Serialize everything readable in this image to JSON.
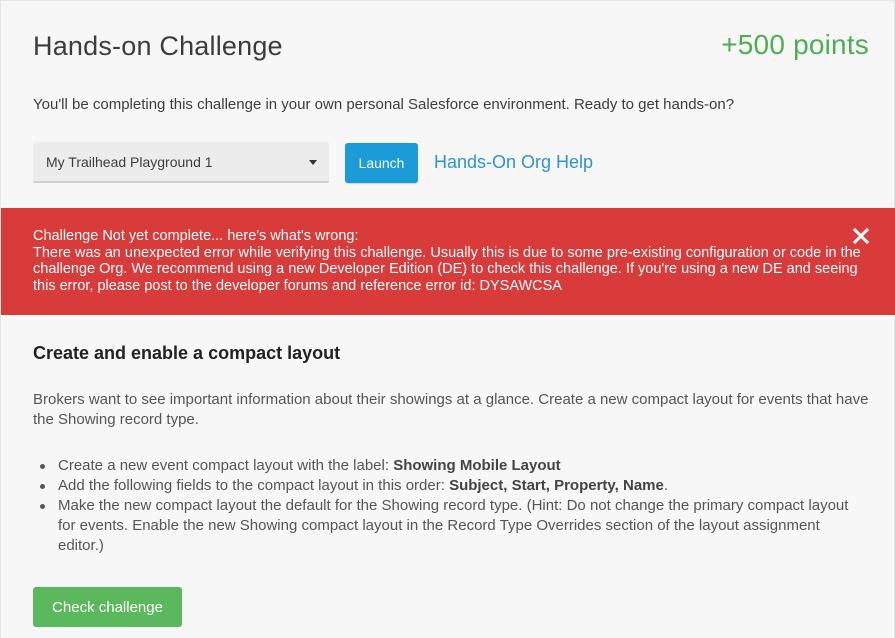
{
  "challenge": {
    "title": "Hands-on Challenge",
    "points": "+500 points",
    "intro": "You'll be completing this challenge in your own personal Salesforce environment. Ready to get hands-on?"
  },
  "controls": {
    "org_select_value": "My Trailhead Playground 1",
    "launch_label": "Launch",
    "help_link_label": "Hands-On Org Help"
  },
  "error": {
    "heading": "Challenge Not yet complete... here's what's wrong:",
    "message": "There was an unexpected error while verifying this challenge. Usually this is due to some pre-existing configuration or code in the challenge Org. We recommend using a new Developer Edition (DE) to check this challenge. If you're using a new DE and seeing this error, please post to the developer forums and reference error id: DYSAWCSA",
    "close_icon": "close-icon"
  },
  "task": {
    "title": "Create and enable a compact layout",
    "description": "Brokers want to see important information about their showings at a glance. Create a new compact layout for events that have the Showing record type.",
    "items": [
      {
        "text": "Create a new event compact layout with the label: ",
        "bold": "Showing Mobile Layout",
        "suffix": ""
      },
      {
        "text": "Add the following fields to the compact layout in this order: ",
        "bold": "Subject, Start, Property, Name",
        "suffix": "."
      },
      {
        "text": "Make the new compact layout the default for the Showing record type. (Hint: Do not change the primary compact layout for events. Enable the new Showing compact layout in the Record Type Overrides section of the layout assignment editor.)",
        "bold": "",
        "suffix": ""
      }
    ],
    "check_label": "Check challenge"
  },
  "colors": {
    "points_green": "#4caf50",
    "launch_blue": "#1b9bd8",
    "link_blue": "#2a94d6",
    "error_red": "#d93b3b",
    "check_green": "#5cb85c"
  }
}
